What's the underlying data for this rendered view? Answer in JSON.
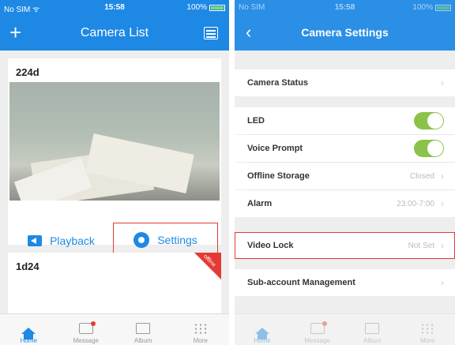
{
  "left": {
    "status": {
      "carrier": "No SIM",
      "time": "15:58",
      "battery": "100%"
    },
    "nav": {
      "title": "Camera List"
    },
    "cameras": [
      {
        "name": "224d"
      },
      {
        "name": "1d24",
        "badge": "offline"
      }
    ],
    "actions": {
      "playback": "Playback",
      "settings": "Settings"
    },
    "tabs": {
      "home": "Home",
      "message": "Message",
      "album": "Album",
      "more": "More"
    }
  },
  "right": {
    "status": {
      "carrier": "No SIM",
      "time": "15:58",
      "battery": "100%"
    },
    "nav": {
      "title": "Camera Settings"
    },
    "settings": {
      "camera_status": "Camera Status",
      "led": "LED",
      "voice_prompt": "Voice Prompt",
      "offline_storage": "Offline Storage",
      "offline_storage_value": "Closed",
      "alarm": "Alarm",
      "alarm_value": "23:00-7:00",
      "video_lock": "Video Lock",
      "video_lock_value": "Not Set",
      "sub_account": "Sub-account Management"
    },
    "tabs": {
      "home": "Home",
      "message": "Message",
      "album": "Album",
      "more": "More"
    }
  },
  "colors": {
    "primary": "#1e88e5",
    "highlight": "#e53935",
    "toggle_on": "#8bc34a"
  },
  "icons": [
    "add-icon",
    "list-icon",
    "back-icon",
    "playback-icon",
    "gear-icon",
    "home-icon",
    "message-icon",
    "album-icon",
    "more-icon",
    "chevron-right-icon",
    "wifi-icon"
  ]
}
